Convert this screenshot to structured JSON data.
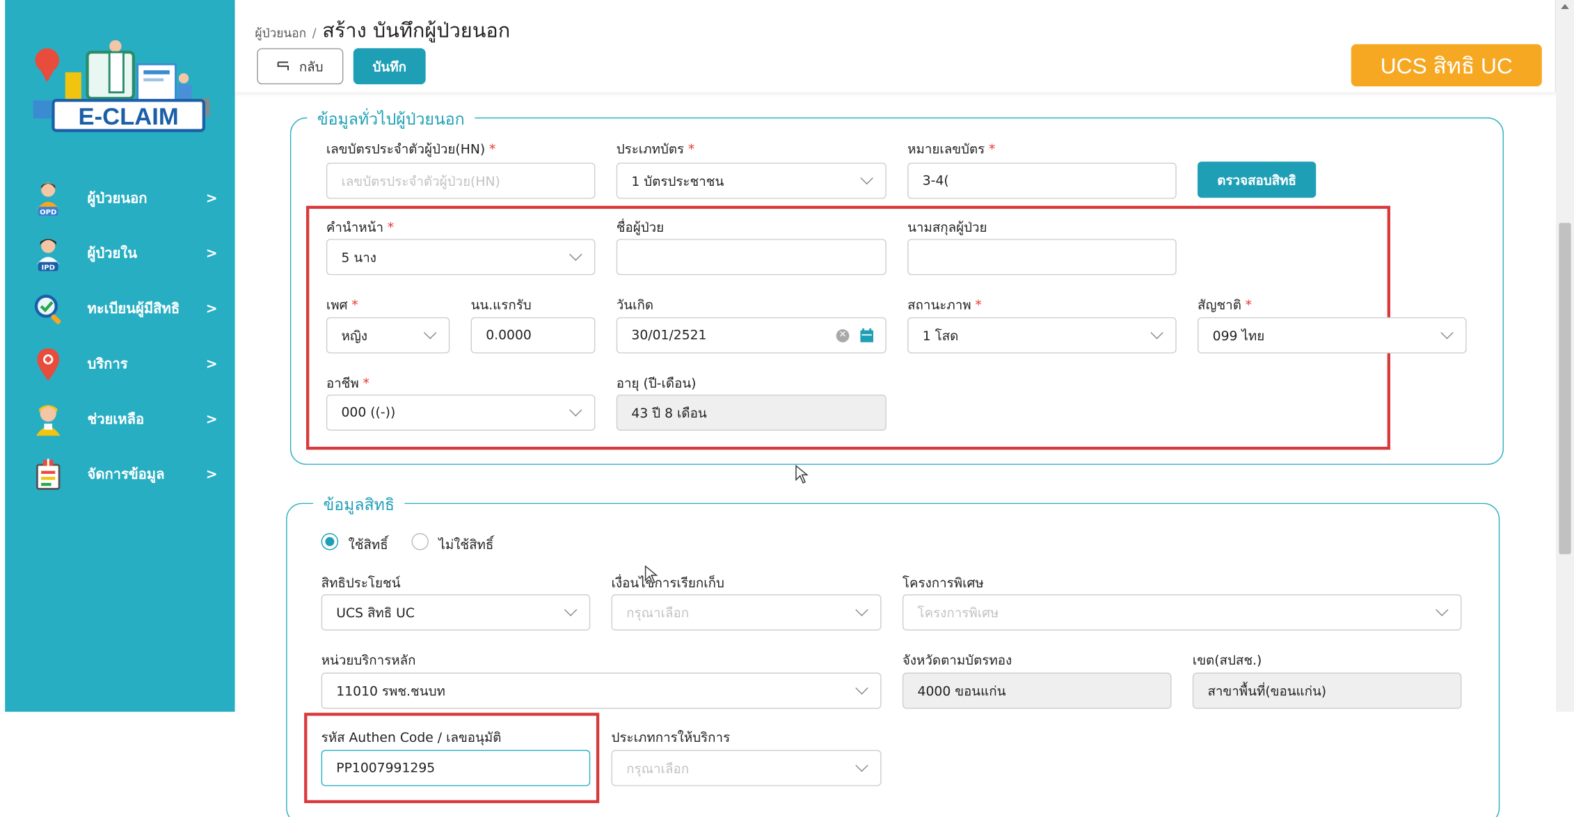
{
  "sidebar": {
    "logo_text": "E-CLAIM",
    "items": [
      {
        "label": "ผู้ป่วยนอก",
        "icon": "opd-patient-icon"
      },
      {
        "label": "ผู้ป่วยใน",
        "icon": "ipd-patient-icon"
      },
      {
        "label": "ทะเบียนผู้มีสิทธิ",
        "icon": "registry-search-icon"
      },
      {
        "label": "บริการ",
        "icon": "service-pin-icon"
      },
      {
        "label": "ช่วยเหลือ",
        "icon": "help-person-icon"
      },
      {
        "label": "จัดการข้อมูล",
        "icon": "data-manage-icon"
      }
    ],
    "arrow": ">"
  },
  "header": {
    "breadcrumb_link": "ผู้ป่วยนอก",
    "breadcrumb_sep": "/",
    "title": "สร้าง บันทึกผู้ป่วยนอก",
    "back_label": "กลับ",
    "save_label": "บันทึก",
    "badge": "UCS สิทธิ UC"
  },
  "general": {
    "legend": "ข้อมูลทั่วไปผู้ป่วยนอก",
    "hn_label": "เลขบัตรประจำตัวผู้ป่วย(HN)",
    "hn_placeholder": "เลขบัตรประจำตัวผู้ป่วย(HN)",
    "card_type_label": "ประเภทบัตร",
    "card_type_value": "1 บัตรประชาชน",
    "card_no_label": "หมายเลขบัตร",
    "card_no_value": "3-4(",
    "check_button": "ตรวจสอบสิทธิ",
    "prefix_label": "คำนำหน้า",
    "prefix_value": "5 นาง",
    "first_name_label": "ชื่อผู้ป่วย",
    "first_name_value": "",
    "last_name_label": "นามสกุลผู้ป่วย",
    "last_name_value": "",
    "sex_label": "เพศ",
    "sex_value": "หญิง",
    "weight_label": "นน.แรกรับ",
    "weight_value": "0.0000",
    "dob_label": "วันเกิด",
    "dob_value": "30/01/2521",
    "marital_label": "สถานะภาพ",
    "marital_value": "1 โสด",
    "nationality_label": "สัญชาติ",
    "nationality_value": "099 ไทย",
    "occupation_label": "อาชีพ",
    "occupation_value": "000 ((-))",
    "age_label": "อายุ (ปี-เดือน)",
    "age_value": "43 ปี 8 เดือน",
    "required_mark": "*"
  },
  "rights": {
    "legend": "ข้อมูลสิทธิ",
    "use_right": "ใช้สิทธิ์",
    "no_right": "ไม่ใช้สิทธิ์",
    "use_right_selected": true,
    "benefit_label": "สิทธิประโยชน์",
    "benefit_value": "UCS สิทธิ UC",
    "condition_label": "เงื่อนไขการเรียกเก็บ",
    "condition_placeholder": "กรุณาเลือก",
    "project_label": "โครงการพิเศษ",
    "project_placeholder": "โครงการพิเศษ",
    "main_unit_label": "หน่วยบริการหลัก",
    "main_unit_value": "11010 รพช.ชนบท",
    "province_label": "จังหวัดตามบัตรทอง",
    "province_value": "4000 ขอนแก่น",
    "region_label": "เขต(สปสช.)",
    "region_value": "สาขาพื้นที่(ขอนแก่น)",
    "authen_label": "รหัส Authen Code / เลขอนุมัติ",
    "authen_value": "PP1007991295",
    "service_type_label": "ประเภทการให้บริการ",
    "service_type_placeholder": "กรุณาเลือก"
  },
  "colors": {
    "sidebar": "#28aec3",
    "accent": "#1f9fb6",
    "badge": "#f6a823",
    "highlight": "#d9393b"
  }
}
